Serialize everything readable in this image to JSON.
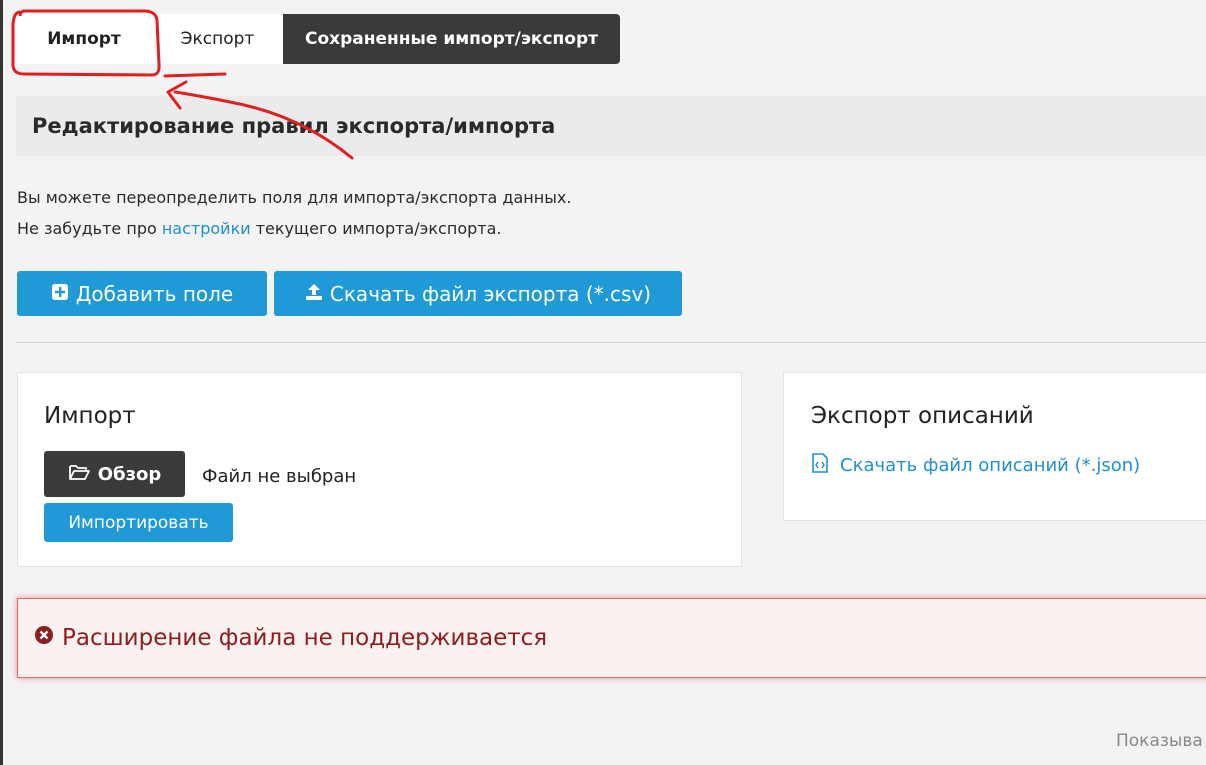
{
  "tabs": [
    {
      "label": "Импорт"
    },
    {
      "label": "Экспорт"
    },
    {
      "label": "Сохраненные импорт/экспорт"
    }
  ],
  "section": {
    "title": "Редактирование правил экспорта/импорта"
  },
  "intro": {
    "line1": "Вы можете переопределить поля для импорта/экспорта данных.",
    "line2_prefix": "Не забудьте про ",
    "line2_link": "настройки",
    "line2_suffix": " текущего импорта/экспорта."
  },
  "actions": {
    "add_field": "Добавить поле",
    "download_csv": "Скачать файл экспорта (*.csv)"
  },
  "import_card": {
    "title": "Импорт",
    "browse": "Обзор",
    "file_status": "Файл не выбран",
    "import_button": "Импортировать"
  },
  "export_card": {
    "title": "Экспорт описаний",
    "json_link": "Скачать файл описаний (*.json)"
  },
  "error": {
    "message": "Расширение файла не поддерживается"
  },
  "footer": {
    "partial_text": "Показыва"
  },
  "colors": {
    "accent": "#1f9ad6",
    "dark_button": "#3a3a3a",
    "error_text": "#8e1d1d",
    "annotation": "#e02020"
  },
  "icons": {
    "add": "plus-square-icon",
    "upload": "upload-icon",
    "browse": "folder-open-icon",
    "json": "code-file-icon",
    "error": "times-circle-icon"
  }
}
